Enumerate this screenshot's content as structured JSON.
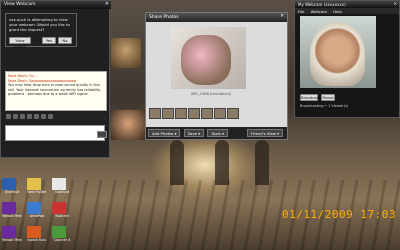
{
  "yahoo": {
    "title": "View Webcam",
    "invite_text": "xxx.ouch is attempting to view your webcam. Would you like to grant the request?",
    "profile_btn": "View Profile",
    "yes_btn": "Yes",
    "no_btn": "No",
    "chat_line1": "Nora Deoh: Co...",
    "chat_line2": "Nora Deoh: Sooooooooooooooooooooo",
    "chat_line3": "You may hear drop outs or poor sound quality in this call. Your Internet connection currently has reliability problems - perhaps due to a weak WiFi signal."
  },
  "share": {
    "title": "Share Photos",
    "caption": "IMG_1488 (thumbnail)",
    "add_btn": "Add Photos ▾",
    "save_btn": "Save ▾",
    "tools_btn": "Tools ▾",
    "next_btn": "Friend's View ▾"
  },
  "cam": {
    "title": "My Webcam (xxxxxxxx)",
    "menu": [
      "File",
      "Webcam",
      "Help"
    ],
    "broadcast_btn": "Broadcast",
    "pause_btn": "Pause",
    "status": "Broadcasting • 1 Viewer(s)"
  },
  "desktop": {
    "icons": [
      {
        "label": "Shortcut"
      },
      {
        "label": "New Folder"
      },
      {
        "label": "Shortcut"
      },
      {
        "label": "Yahoo! Messenger"
      },
      {
        "label": "wordPad"
      },
      {
        "label": "Buzz ed"
      },
      {
        "label": "Yahoo! Messenger"
      },
      {
        "label": "sudah hulu"
      },
      {
        "label": "Counter 4"
      }
    ]
  },
  "timestamp": "01/11/2009  17:03",
  "colors": {
    "timestamp": "#ffb000"
  }
}
